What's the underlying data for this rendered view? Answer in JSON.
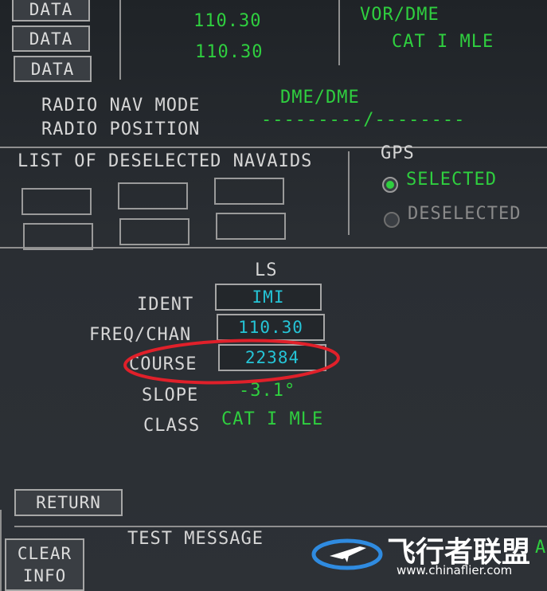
{
  "top_left_buttons": [
    "DATA",
    "DATA",
    "DATA"
  ],
  "top_freqs": [
    "110.30",
    "110.30"
  ],
  "top_right": {
    "mode_label": "VOR/DME",
    "cat_label": "CAT I MLE"
  },
  "radio_nav": {
    "mode_label": "RADIO NAV MODE",
    "mode_value": "DME/DME",
    "position_label": "RADIO POSITION",
    "position_value": "---------/--------"
  },
  "deselected": {
    "title": "LIST OF DESELECTED NAVAIDS"
  },
  "gps": {
    "title": "GPS",
    "selected_label": "SELECTED",
    "deselected_label": "DESELECTED",
    "selected_state": "SELECTED"
  },
  "ls": {
    "title": "LS",
    "ident_label": "IDENT",
    "ident_value": "IMI",
    "freq_label": "FREQ/CHAN",
    "freq_value": "110.30",
    "course_label": "COURSE",
    "course_value": "22384",
    "slope_label": "SLOPE",
    "slope_value": "-3.1°",
    "class_label": "CLASS",
    "class_value": "CAT I MLE"
  },
  "return_label": "RETURN",
  "message": {
    "title": "TEST MESSAGE",
    "trailing": "A"
  },
  "clear_info": {
    "line1": "CLEAR",
    "line2": "INFO"
  },
  "watermark": {
    "name": "飞行者联盟",
    "url": "www.chinaflier.com"
  },
  "colors": {
    "green": "#2fcf3f",
    "cyan": "#25c4d6",
    "annotation": "#e0202a"
  }
}
